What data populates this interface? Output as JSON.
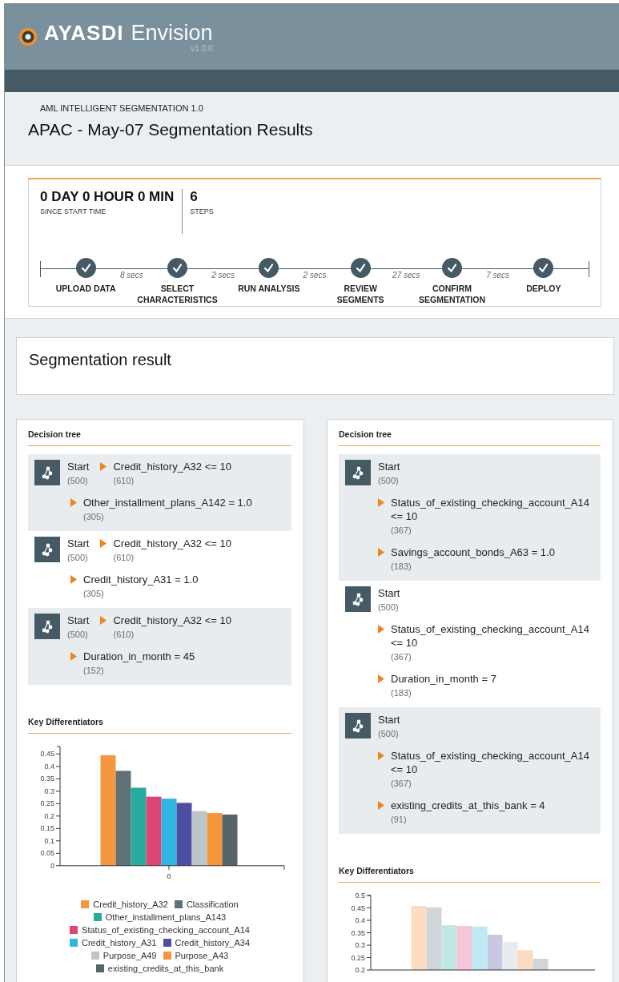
{
  "header": {
    "brand": "AYASDI",
    "product": "Envision",
    "version": "v1.0.0"
  },
  "page": {
    "subtitle": "AML INTELLIGENT SEGMENTATION 1.0",
    "title": "APAC - May-07 Segmentation Results"
  },
  "progress": {
    "elapsed": "0 DAY 0 HOUR 0 MIN",
    "elapsed_caption": "SINCE START TIME",
    "steps_count": "6",
    "steps_caption": "STEPS",
    "steps": [
      {
        "label": "UPLOAD DATA",
        "done": true,
        "time_after": "8 secs"
      },
      {
        "label": "SELECT CHARACTERISTICS",
        "done": true,
        "time_after": "2 secs"
      },
      {
        "label": "RUN ANALYSIS",
        "done": true,
        "time_after": "2 secs"
      },
      {
        "label": "REVIEW SEGMENTS",
        "done": true,
        "time_after": "27 secs"
      },
      {
        "label": "CONFIRM SEGMENTATION",
        "done": true,
        "time_after": "7 secs"
      },
      {
        "label": "DEPLOY",
        "done": true
      }
    ]
  },
  "result": {
    "title": "Segmentation result"
  },
  "panels": [
    {
      "tree_title": "Decision tree",
      "kind": "inline",
      "trees": [
        {
          "nodes": [
            {
              "label": "Start",
              "count": "(500)"
            },
            {
              "label": "Credit_history_A32 <= 10",
              "count": "(610)"
            },
            {
              "label": "Other_installment_plans_A142 = 1.0",
              "count": "(305)"
            }
          ]
        },
        {
          "nodes": [
            {
              "label": "Start",
              "count": "(500)"
            },
            {
              "label": "Credit_history_A32 <= 10",
              "count": "(610)"
            },
            {
              "label": "Credit_history_A31 = 1.0",
              "count": "(305)"
            }
          ]
        },
        {
          "nodes": [
            {
              "label": "Start",
              "count": "(500)"
            },
            {
              "label": "Credit_history_A32 <= 10",
              "count": "(610)"
            },
            {
              "label": "Duration_in_month = 45",
              "count": "(152)"
            }
          ]
        }
      ],
      "chart_title": "Key Differentiators",
      "chart_data": {
        "type": "bar",
        "categories": [
          "0"
        ],
        "legend": "bottom",
        "ylim": [
          0,
          0.48
        ],
        "yticks": [
          0,
          0.05,
          0.1,
          0.15,
          0.2,
          0.25,
          0.3,
          0.35,
          0.4,
          0.45
        ],
        "series": [
          {
            "name": "Credit_history_A32",
            "color": "#f5973f",
            "values": [
              0.445
            ]
          },
          {
            "name": "Classification",
            "color": "#5f7076",
            "values": [
              0.382
            ]
          },
          {
            "name": "Other_installment_plans_A143",
            "color": "#26ab9d",
            "values": [
              0.314
            ]
          },
          {
            "name": "Status_of_existing_checking_account_A14",
            "color": "#dc4675",
            "values": [
              0.278
            ]
          },
          {
            "name": "Credit_history_A31",
            "color": "#31b6e4",
            "values": [
              0.27
            ]
          },
          {
            "name": "Credit_history_A34",
            "color": "#4e4ea0",
            "values": [
              0.253
            ]
          },
          {
            "name": "Purpose_A49",
            "color": "#bcc6ca",
            "values": [
              0.22
            ]
          },
          {
            "name": "Purpose_A43",
            "color": "#f5963a",
            "values": [
              0.212
            ]
          },
          {
            "name": "existing_credits_at_this_bank",
            "color": "#566569",
            "values": [
              0.206
            ]
          }
        ]
      }
    },
    {
      "tree_title": "Decision tree",
      "kind": "stacked",
      "trees": [
        {
          "nodes": [
            {
              "label": "Start",
              "count": "(500)"
            },
            {
              "label": "Status_of_existing_checking_account_A14 <= 10",
              "count": "(367)"
            },
            {
              "label": "Savings_account_bonds_A63 = 1.0",
              "count": "(183)"
            }
          ]
        },
        {
          "nodes": [
            {
              "label": "Start",
              "count": "(500)"
            },
            {
              "label": "Status_of_existing_checking_account_A14 <= 10",
              "count": "(367)"
            },
            {
              "label": "Duration_in_month = 7",
              "count": "(183)"
            }
          ]
        },
        {
          "nodes": [
            {
              "label": "Start",
              "count": "(500)"
            },
            {
              "label": "Status_of_existing_checking_account_A14 <= 10",
              "count": "(367)"
            },
            {
              "label": "existing_credits_at_this_bank = 4",
              "count": "(91)"
            }
          ]
        }
      ],
      "chart_title": "Key Differentiators",
      "chart_data": {
        "type": "bar",
        "ylim": [
          0.2,
          0.5
        ],
        "yticks": [
          0.2,
          0.25,
          0.3,
          0.35,
          0.4,
          0.45,
          0.5
        ],
        "series": [
          {
            "color": "#fbdcc0",
            "values": [
              0.458
            ]
          },
          {
            "color": "#cfd5d8",
            "values": [
              0.452
            ]
          },
          {
            "color": "#bfe7e3",
            "values": [
              0.38
            ]
          },
          {
            "color": "#f5c6d7",
            "values": [
              0.377
            ]
          },
          {
            "color": "#bfe8f5",
            "values": [
              0.375
            ]
          },
          {
            "color": "#c9c8e3",
            "values": [
              0.342
            ]
          },
          {
            "color": "#e8ecee",
            "values": [
              0.313
            ]
          },
          {
            "color": "#fbdcc0",
            "values": [
              0.28
            ]
          },
          {
            "color": "#cfd5d8",
            "values": [
              0.245
            ]
          }
        ]
      }
    }
  ]
}
